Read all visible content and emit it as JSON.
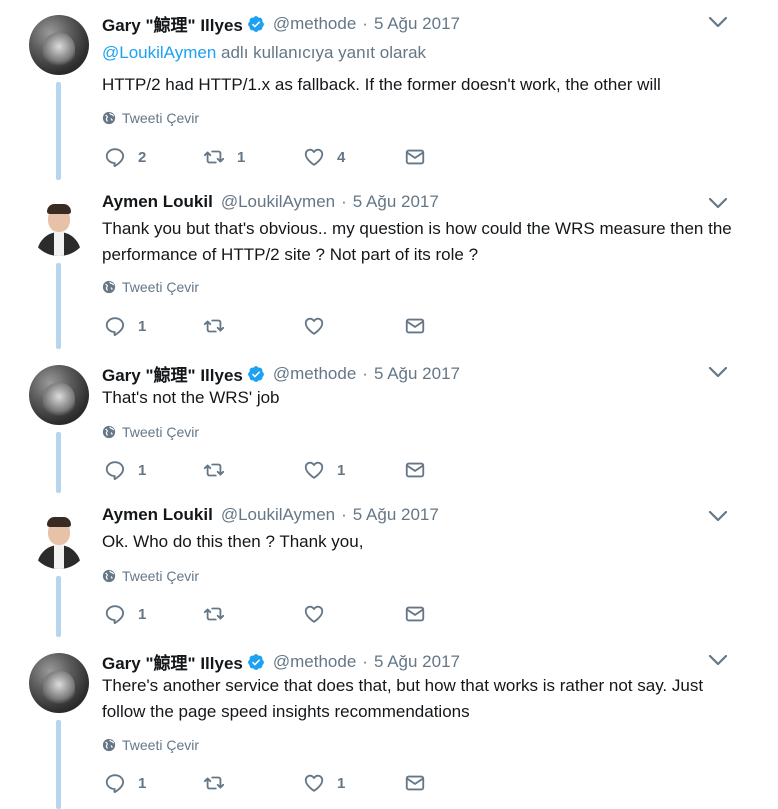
{
  "tweets": [
    {
      "author_name": "Gary \"鯨理\" Illyes",
      "verified": true,
      "handle": "@methode",
      "separator": "·",
      "date": "5 Ağu 2017",
      "reply_prefix": "@LoukilAymen",
      "reply_suffix": " adlı kullanıcıya yanıt olarak",
      "text": "HTTP/2 had HTTP/1.x as fallback. If the former doesn't work, the other will",
      "translate_label": "Tweeti Çevir",
      "reply_count": "2",
      "retweet_count": "1",
      "like_count": "4",
      "avatar": "gary-avatar"
    },
    {
      "author_name": "Aymen Loukil",
      "verified": false,
      "handle": "@LoukilAymen",
      "separator": "·",
      "date": "5 Ağu 2017",
      "text": "Thank you but that's obvious.. my question is how could the WRS measure then the performance of HTTP/2 site ? Not part of its role ?",
      "translate_label": "Tweeti Çevir",
      "reply_count": "1",
      "retweet_count": "",
      "like_count": "",
      "avatar": "aymen-avatar"
    },
    {
      "author_name": "Gary \"鯨理\" Illyes",
      "verified": true,
      "handle": "@methode",
      "separator": "·",
      "date": "5 Ağu 2017",
      "text": "That's not the WRS' job",
      "translate_label": "Tweeti Çevir",
      "reply_count": "1",
      "retweet_count": "",
      "like_count": "1",
      "avatar": "gary-avatar"
    },
    {
      "author_name": "Aymen Loukil",
      "verified": false,
      "handle": "@LoukilAymen",
      "separator": "·",
      "date": "5 Ağu 2017",
      "text": "Ok. Who do this then ? Thank you,",
      "translate_label": "Tweeti Çevir",
      "reply_count": "1",
      "retweet_count": "",
      "like_count": "",
      "avatar": "aymen-avatar"
    },
    {
      "author_name": "Gary \"鯨理\" Illyes",
      "verified": true,
      "handle": "@methode",
      "separator": "·",
      "date": "5 Ağu 2017",
      "text": "There's another service that does that, but how that works is rather not say. Just follow the page speed insights recommendations",
      "translate_label": "Tweeti Çevir",
      "reply_count": "1",
      "retweet_count": "",
      "like_count": "1",
      "avatar": "gary-avatar"
    }
  ],
  "colors": {
    "link": "#1da1f2",
    "muted": "#657786",
    "text": "#14171a",
    "thread_line": "#b6d5ef",
    "verified": "#1da1f2"
  },
  "icons": [
    "globe-icon",
    "reply-icon",
    "retweet-icon",
    "like-icon",
    "direct-message-icon",
    "chevron-down-icon",
    "verified-badge-icon"
  ]
}
